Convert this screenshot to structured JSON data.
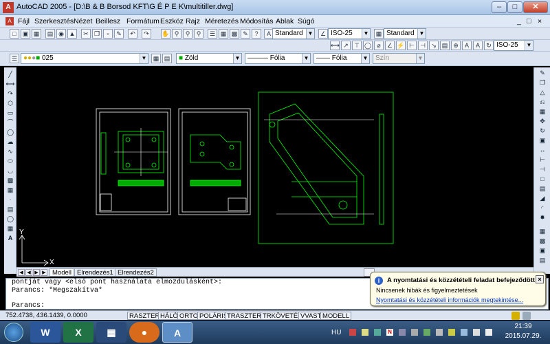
{
  "window": {
    "title": "AutoCAD 2005 - [D:\\B & B Borsod KFT\\G É P E K\\multitiller.dwg]"
  },
  "menu": [
    "Fájl",
    "Szerkesztés",
    "Nézet",
    "Beillesz",
    "Formátum",
    "Eszköz",
    "Rajz",
    "Méretezés",
    "Módosítás",
    "Ablak",
    "Súgó"
  ],
  "styles_toolbar": {
    "text_style": "Standard",
    "dim_style": "ISO-25",
    "table_style": "Standard"
  },
  "dim_toolbar": {
    "dim_style": "ISO-25"
  },
  "layer_toolbar": {
    "layer": "025",
    "color": "Zöld",
    "linetype": "Fólia",
    "lineweight": "Fólia",
    "plotstyle": "Szín"
  },
  "colors": {
    "drawing": "#00ff00",
    "background": "#000000",
    "accent": "#0a246a"
  },
  "tabs": [
    "Modell",
    "Elrendezés1",
    "Elrendezés2"
  ],
  "ucs": {
    "x": "X",
    "y": "Y"
  },
  "command_lines": [
    "pontját vagy <első pont használata elmozdulásként>:",
    "Parancs: *Megszakítva*",
    "",
    "Parancs:"
  ],
  "status": {
    "coords": "752.4738, 436.1439, 0.0000",
    "buttons": [
      "RASZTER",
      "HÁLÓ",
      "ORTO",
      "POLÁRIS",
      "TRASZTER",
      "TRKÖVETÉS",
      "VVASTAG",
      "MODELL"
    ]
  },
  "notification": {
    "title": "A nyomtatási és közzétételi feladat befejeződött",
    "message": "Nincsenek hibák és figyelmeztetések",
    "link": "Nyomtatási és közzétételi információk megtekintése..."
  },
  "taskbar": {
    "language": "HU",
    "time": "21:39",
    "date": "2015.07.29."
  }
}
